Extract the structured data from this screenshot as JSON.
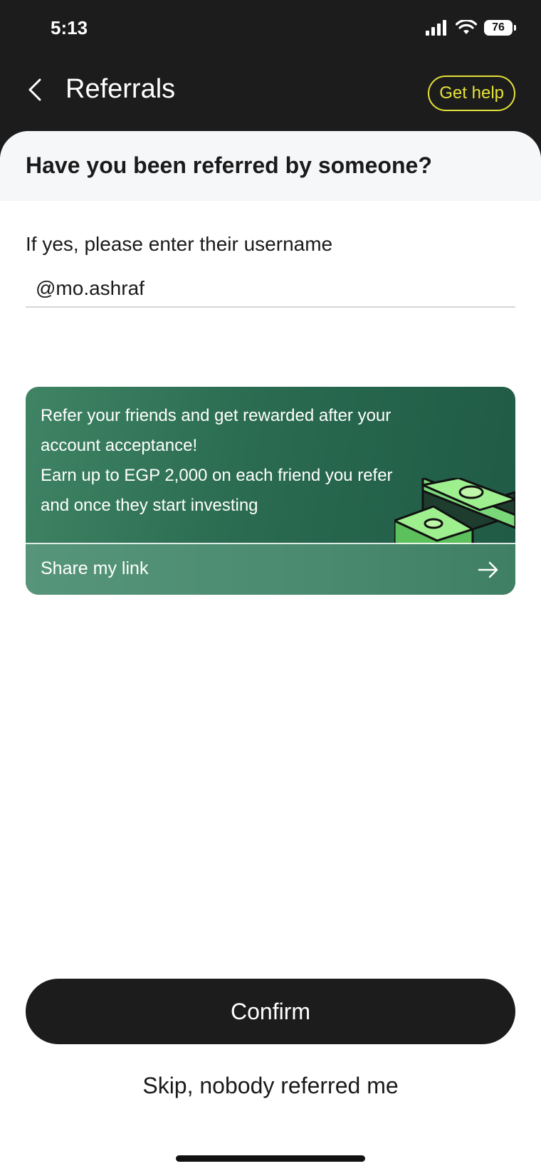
{
  "status_bar": {
    "time": "5:13",
    "battery": "76"
  },
  "header": {
    "title": "Referrals",
    "help_label": "Get help"
  },
  "referral_form": {
    "question": "Have you been referred by someone?",
    "input_label": "If yes, please enter their username",
    "username_value": "@mo.ashraf"
  },
  "promo_card": {
    "line1": "Refer your friends and get rewarded after your account acceptance!",
    "line2": "Earn up to EGP 2,000 on each friend you refer and once they start investing",
    "share_label": "Share my link",
    "icons": {
      "illustration": "money-stack-icon",
      "action": "arrow-right-icon"
    },
    "colors": {
      "card_start": "#3f8464",
      "card_end": "#1f5a45"
    }
  },
  "actions": {
    "confirm_label": "Confirm",
    "skip_label": "Skip, nobody referred me"
  },
  "colors": {
    "accent": "#e6e23a",
    "dark": "#1c1c1c"
  }
}
